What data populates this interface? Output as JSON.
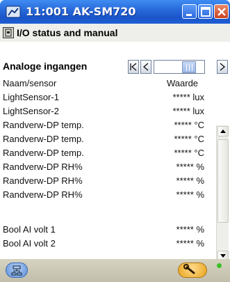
{
  "window": {
    "title": "11:001 AK-SM720",
    "icons": {
      "app": "gauge-icon",
      "minimize": "minimize-icon",
      "maximize": "maximize-icon",
      "close": "close-icon"
    }
  },
  "header": {
    "icon": "io-icon",
    "title": "I/O status and manual"
  },
  "section": {
    "title": "Analoge ingangen",
    "nav": {
      "first": "|<",
      "prev": "<",
      "next": "+"
    }
  },
  "table": {
    "columns": [
      "Naam/sensor",
      "Waarde"
    ],
    "rows": [
      {
        "name": "LightSensor-1",
        "value": "***** lux"
      },
      {
        "name": "LightSensor-2",
        "value": "***** lux"
      },
      {
        "name": "Randverw-DP temp.",
        "value": "***** °C"
      },
      {
        "name": "Randverw-DP temp.",
        "value": "***** °C"
      },
      {
        "name": "Randverw-DP temp.",
        "value": "***** °C"
      },
      {
        "name": "Randverw-DP RH%",
        "value": "***** %"
      },
      {
        "name": "Randverw-DP RH%",
        "value": "***** %"
      },
      {
        "name": "Randverw-DP RH%",
        "value": "***** %"
      },
      {
        "name": "",
        "value": ""
      },
      {
        "name": "Bool AI volt 1",
        "value": "***** %"
      },
      {
        "name": "Bool AI volt 2",
        "value": "***** %"
      }
    ]
  },
  "bottom": {
    "left_icon": "network-icon",
    "right_icon": "wrench-icon",
    "status_color": "#39c024"
  }
}
